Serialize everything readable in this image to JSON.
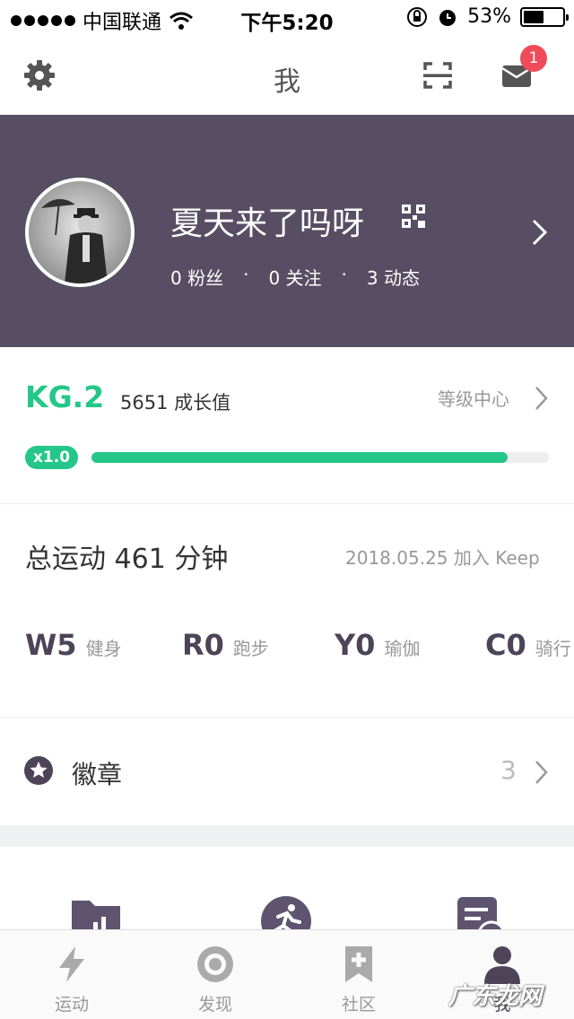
{
  "status_bar": {
    "carrier": "中国联通",
    "time": "下午5:20",
    "battery": "53%",
    "battery_level": 0.53
  },
  "nav": {
    "title": "我",
    "icons": [
      "gear-icon",
      "scan-icon",
      "mail-icon"
    ],
    "mail_badge": "1"
  },
  "profile": {
    "name": "夏天来了吗呀",
    "fans": "0 粉丝",
    "following": "0 关注",
    "posts": "3 动态",
    "separator": "·"
  },
  "level": {
    "badge": "KG.2",
    "growth": "5651 成长值",
    "center_label": "等级中心",
    "multiplier": "x1.0",
    "progress": 0.91
  },
  "exercise": {
    "total": "总运动 461 分钟",
    "joined": "2018.05.25 加入 Keep",
    "items": [
      {
        "code": "W5",
        "name": "健身"
      },
      {
        "code": "R0",
        "name": "跑步"
      },
      {
        "code": "Y0",
        "name": "瑜伽"
      },
      {
        "code": "C0",
        "name": "骑行"
      }
    ]
  },
  "badges": {
    "title": "徽章",
    "count": "3"
  },
  "tabs": [
    {
      "label": "运动",
      "icon": "lightning-icon"
    },
    {
      "label": "发现",
      "icon": "discover-icon"
    },
    {
      "label": "社区",
      "icon": "bookmark-plus-icon"
    },
    {
      "label": "我",
      "icon": "person-icon"
    }
  ],
  "watermark": "广东龙网",
  "colors": {
    "accent_green": "#24c789",
    "header_purple": "#584e63",
    "badge_red": "#f04b5a"
  }
}
